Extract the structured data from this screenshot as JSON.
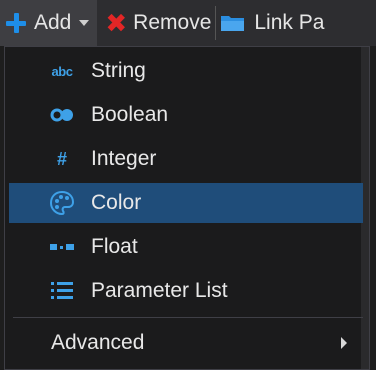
{
  "toolbar": {
    "add_label": "Add",
    "remove_label": "Remove",
    "link_label": "Link Pa"
  },
  "menu": {
    "items": [
      {
        "label": "String",
        "icon": "abc-icon",
        "icon_text": "abc"
      },
      {
        "label": "Boolean",
        "icon": "toggle-icon"
      },
      {
        "label": "Integer",
        "icon": "hash-icon",
        "icon_text": "#"
      },
      {
        "label": "Color",
        "icon": "palette-icon",
        "selected": true
      },
      {
        "label": "Float",
        "icon": "float-icon"
      },
      {
        "label": "Parameter List",
        "icon": "list-icon"
      }
    ],
    "advanced_label": "Advanced"
  },
  "colors": {
    "accent": "#3ea1e8",
    "selected_bg": "#1f4d7a",
    "remove_red": "#e32626",
    "folder": "#2b8ee0"
  }
}
